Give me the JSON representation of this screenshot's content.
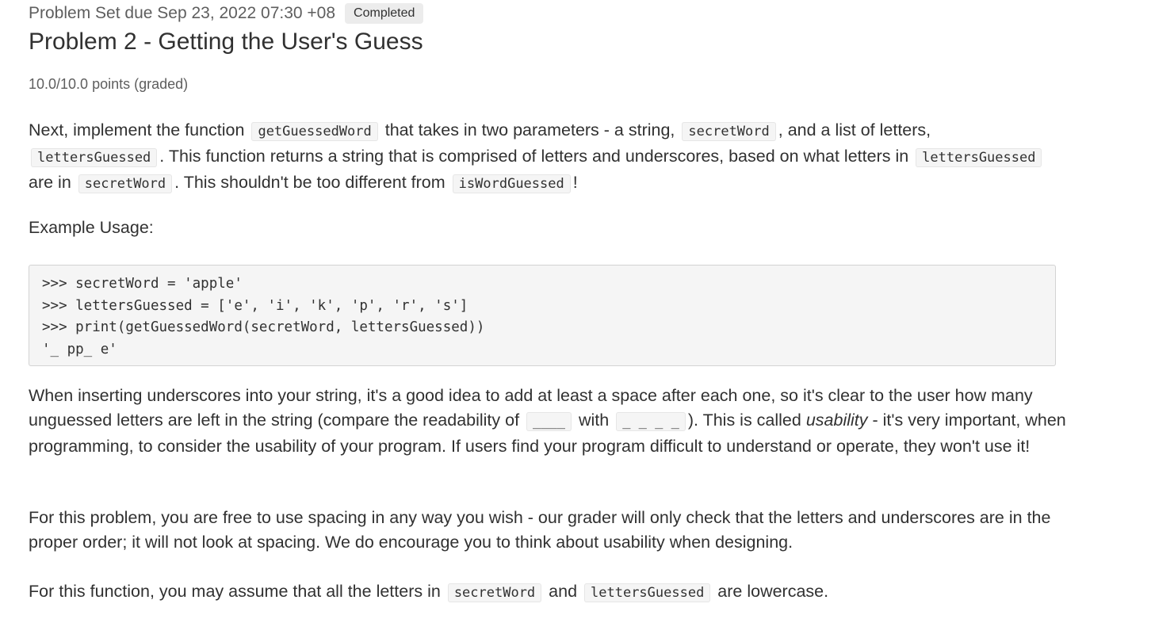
{
  "header": {
    "due": "Problem Set due Sep 23, 2022 07:30 +08",
    "status_badge": "Completed",
    "title": "Problem 2 - Getting the User's Guess",
    "points": "10.0/10.0 points (graded)"
  },
  "p1": {
    "t1": "Next, implement the function",
    "c1": "getGuessedWord",
    "t2": "that takes in two parameters - a string,",
    "c2": "secretWord",
    "t3": ", and a list of letters,",
    "c3": "lettersGuessed",
    "t4": ". This function returns a string that is comprised of letters and underscores, based on what letters in",
    "c4": "lettersGuessed",
    "t5": "are in",
    "c5": "secretWord",
    "t6": ". This shouldn't be too different from",
    "c6": "isWordGuessed",
    "t7": "!"
  },
  "example_heading": "Example Usage:",
  "code_lines": [
    ">>> secretWord = 'apple'",
    ">>> lettersGuessed = ['e', 'i', 'k', 'p', 'r', 's']",
    ">>> print(getGuessedWord(secretWord, lettersGuessed))",
    "'_ pp_ e'"
  ],
  "p3": {
    "t1": "When inserting underscores into your string, it's a good idea to add at least a space after each one, so it's clear to the user how many unguessed letters are left in the string (compare the readability of",
    "c1": "____",
    "t2": "with",
    "c2": "_ _ _ _",
    "t3": "). This is called",
    "em": "usability",
    "t4": "- it's very important, when programming, to consider the usability of your program. If users find your program difficult to understand or operate, they won't use it!"
  },
  "p4": "For this problem, you are free to use spacing in any way you wish - our grader will only check that the letters and underscores are in the proper order; it will not look at spacing. We do encourage you to think about usability when designing.",
  "p5": {
    "t1": "For this function, you may assume that all the letters in",
    "c1": "secretWord",
    "t2": "and",
    "c2": "lettersGuessed",
    "t3": "are lowercase."
  }
}
